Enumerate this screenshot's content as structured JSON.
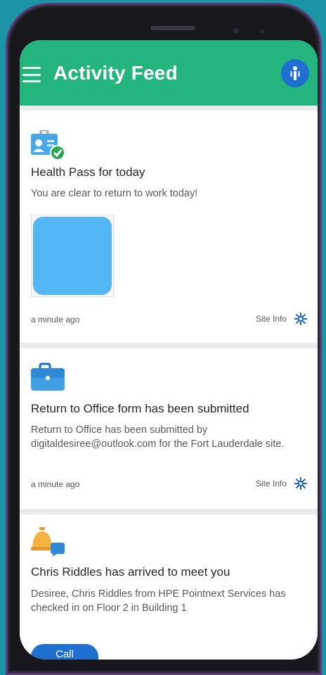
{
  "app": {
    "title": "Activity Feed"
  },
  "icons": {
    "menu": "hamburger-menu-icon",
    "user": "person-avatar-icon",
    "site": "gear-icon"
  },
  "colors": {
    "appbar": "#24b47e",
    "accent": "#1f6fd1",
    "background": "#1b94a6"
  },
  "cards": [
    {
      "title": "Health Pass for today",
      "body": "You are clear to return to work today!",
      "time": "a minute ago",
      "link": "Site Info"
    },
    {
      "title": "Return to Office form has been submitted",
      "body": "Return to Office has been submitted by digitaldesiree@outlook.com for the Fort Lauderdale site.",
      "time": "a minute ago",
      "link": "Site Info"
    },
    {
      "title": "Chris Riddles has arrived to meet you",
      "body": "Desiree, Chris Riddles from HPE Pointnext Services has checked in on Floor 2 in Building 1",
      "action": "Call"
    }
  ]
}
